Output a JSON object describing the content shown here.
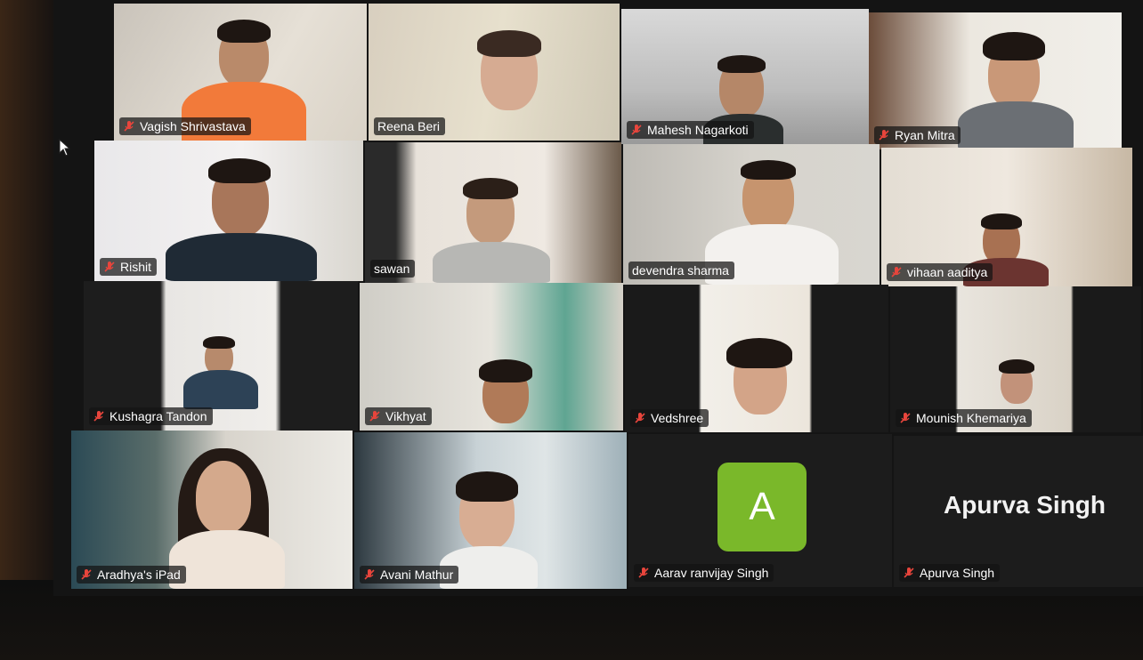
{
  "colors": {
    "muted_mic": "#e8453c",
    "active_speaker_border": "#39c36a",
    "avatar_bg": "#7ab82a"
  },
  "participants": [
    {
      "name": "Vagish Shrivastava",
      "muted": true
    },
    {
      "name": "Reena Beri",
      "muted": false
    },
    {
      "name": "Mahesh Nagarkoti",
      "muted": true
    },
    {
      "name": "Ryan Mitra",
      "muted": true
    },
    {
      "name": "Rishit",
      "muted": true
    },
    {
      "name": "sawan",
      "muted": false
    },
    {
      "name": "devendra sharma",
      "muted": false,
      "active_speaker": true
    },
    {
      "name": "vihaan aaditya",
      "muted": true
    },
    {
      "name": "Kushagra Tandon",
      "muted": true
    },
    {
      "name": "Vikhyat",
      "muted": true
    },
    {
      "name": "Vedshree",
      "muted": true
    },
    {
      "name": "Mounish Khemariya",
      "muted": true
    },
    {
      "name": "Aradhya's iPad",
      "muted": true
    },
    {
      "name": "Avani Mathur",
      "muted": true
    },
    {
      "name": "Aarav ranvijay Singh",
      "muted": true,
      "avatar_letter": "A"
    },
    {
      "name": "Apurva Singh",
      "muted": true,
      "video_off": true
    }
  ]
}
